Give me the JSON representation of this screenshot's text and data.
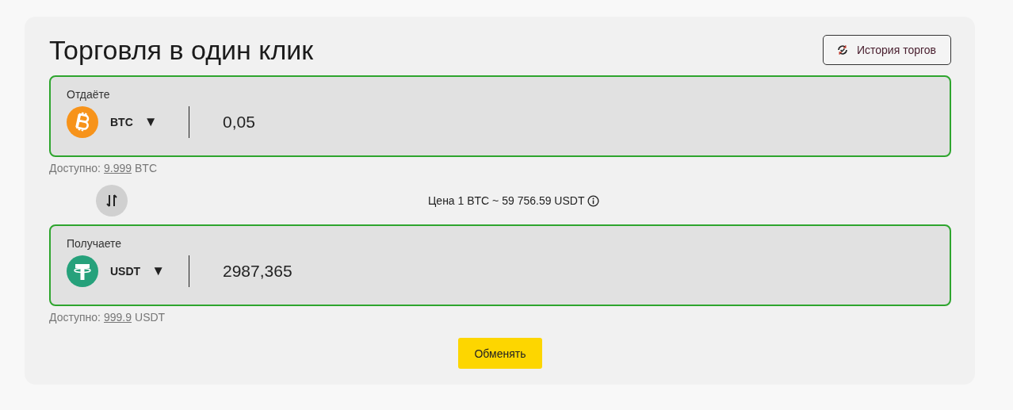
{
  "title": "Торговля в один клик",
  "history_button": {
    "label": "История торгов"
  },
  "give": {
    "label": "Отдаёте",
    "currency": "BTC",
    "kind": "bitcoin",
    "caret": "▼",
    "amount": "0,05",
    "balance": {
      "label": "Доступно:",
      "amount": "9.999",
      "unit": "BTC"
    }
  },
  "rate": "Цена 1 BTC ~ 59 756.59 USDT",
  "receive": {
    "label": "Получаете",
    "currency": "USDT",
    "kind": "tether",
    "caret": "▼",
    "amount": "2987,365",
    "balance": {
      "label": "Доступно:",
      "amount": "999.9",
      "unit": "USDT"
    }
  },
  "submit_button": {
    "label": "Обменять"
  }
}
